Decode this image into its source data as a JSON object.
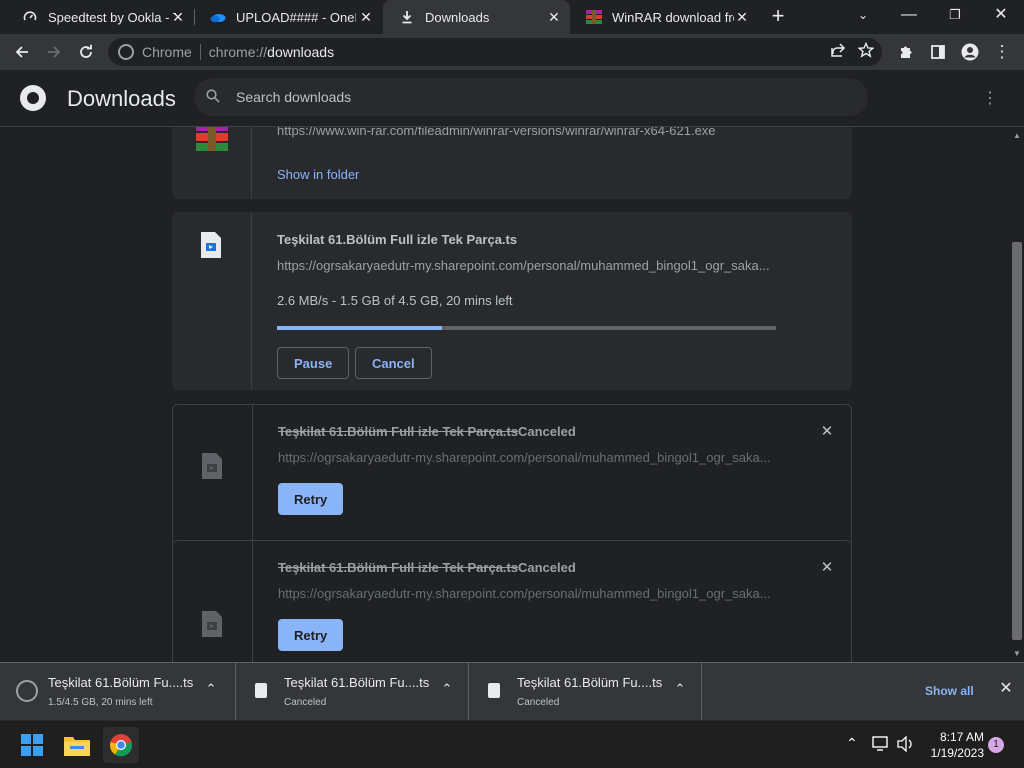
{
  "tabs": [
    {
      "title": "Speedtest by Ookla - T",
      "icon": "speedtest-icon"
    },
    {
      "title": "UPLOAD#### - OneDri",
      "icon": "onedrive-icon"
    },
    {
      "title": "Downloads",
      "icon": "download-icon",
      "active": true
    },
    {
      "title": "WinRAR download free",
      "icon": "winrar-icon"
    }
  ],
  "omnibox": {
    "site": "Chrome",
    "scheme": "chrome://",
    "host": "downloads"
  },
  "header": {
    "title": "Downloads",
    "search_placeholder": "Search downloads"
  },
  "cards": {
    "c0": {
      "url": "https://www.win-rar.com/fileadmin/winrar-versions/winrar/winrar-x64-621.exe",
      "link": "Show in folder"
    },
    "c1": {
      "title": "Teşkilat 61.Bölüm Full izle Tek Parça.ts",
      "url": "https://ogrsakaryaedutr-my.sharepoint.com/personal/muhammed_bingol1_ogr_saka...",
      "progress_text": "2.6 MB/s - 1.5 GB of 4.5 GB, 20 mins left",
      "progress": 0.33,
      "pause": "Pause",
      "cancel": "Cancel"
    },
    "c2": {
      "title": "Teşkilat 61.Bölüm Full izle Tek Parça.ts",
      "status": "Canceled",
      "url": "https://ogrsakaryaedutr-my.sharepoint.com/personal/muhammed_bingol1_ogr_saka...",
      "retry": "Retry"
    },
    "c3": {
      "title": "Teşkilat 61.Bölüm Full izle Tek Parça.ts",
      "status": "Canceled",
      "url": "https://ogrsakaryaedutr-my.sharepoint.com/personal/muhammed_bingol1_ogr_saka...",
      "retry": "Retry"
    }
  },
  "shelf": {
    "items": [
      {
        "name": "Teşkilat 61.Bölüm Fu....ts",
        "sub": "1.5/4.5 GB, 20 mins left"
      },
      {
        "name": "Teşkilat 61.Bölüm Fu....ts",
        "sub": "Canceled"
      },
      {
        "name": "Teşkilat 61.Bölüm Fu....ts",
        "sub": "Canceled"
      }
    ],
    "show_all": "Show all"
  },
  "taskbar": {
    "time": "8:17 AM",
    "date": "1/19/2023",
    "notifications": "1"
  },
  "colors": {
    "accent": "#8ab4f8",
    "background": "#202124",
    "card": "#292a2d"
  }
}
